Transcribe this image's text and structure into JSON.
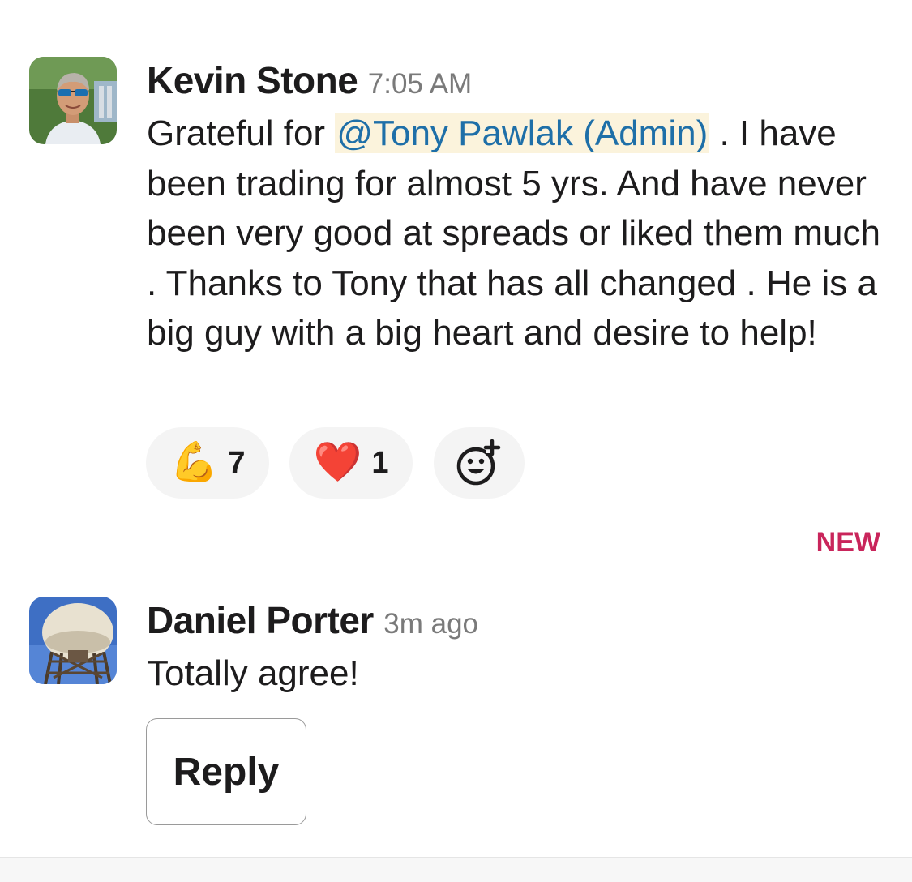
{
  "messages": [
    {
      "author": "Kevin Stone",
      "time": "7:05 AM",
      "text_before": "Grateful for ",
      "mention": "@Tony Pawlak (Admin)",
      "text_after": " . I have been trading for almost 5 yrs. And have never been very good at spreads or liked them  much . Thanks to Tony that has all changed . He is a big guy with a big heart and desire to help!",
      "reactions": [
        {
          "emoji": "💪",
          "icon": "flexed-biceps-icon",
          "count": "7"
        },
        {
          "emoji": "❤️",
          "icon": "red-heart-icon",
          "count": "1"
        }
      ],
      "add_reaction_icon": "add-reaction-icon"
    },
    {
      "author": "Daniel Porter",
      "time": "3m ago",
      "text": "Totally agree!"
    }
  ],
  "new_label": "NEW",
  "reply_label": "Reply",
  "colors": {
    "mention_bg": "#fbf3dc",
    "mention_text": "#1e6fa8",
    "new_accent": "#c9255b"
  }
}
